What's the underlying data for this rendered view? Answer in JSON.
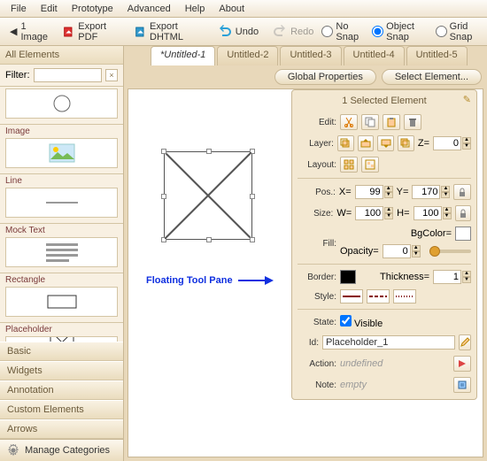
{
  "menu": {
    "file": "File",
    "edit": "Edit",
    "prototype": "Prototype",
    "advanced": "Advanced",
    "help": "Help",
    "about": "About"
  },
  "toolbar": {
    "image": "1 Image",
    "exportPdf": "Export PDF",
    "exportDhtml": "Export DHTML",
    "undo": "Undo",
    "redo": "Redo"
  },
  "snap": {
    "noSnap": "No Snap",
    "objectSnap": "Object Snap",
    "gridSnap": "Grid Snap",
    "selected": "objectSnap"
  },
  "sidebar": {
    "header": "All Elements",
    "filterLabel": "Filter:",
    "items": [
      {
        "label": ""
      },
      {
        "label": "Image"
      },
      {
        "label": "Line"
      },
      {
        "label": "Mock Text"
      },
      {
        "label": "Rectangle"
      },
      {
        "label": "Placeholder"
      }
    ],
    "categories": [
      "Basic",
      "Widgets",
      "Annotation",
      "Custom Elements",
      "Arrows"
    ],
    "manage": "Manage Categories"
  },
  "tabs": [
    "*Untitled-1",
    "Untitled-2",
    "Untitled-3",
    "Untitled-4",
    "Untitled-5"
  ],
  "propsBar": {
    "global": "Global Properties",
    "select": "Select Element..."
  },
  "annotation": "Floating Tool Pane",
  "tp": {
    "title": "1 Selected Element",
    "labels": {
      "edit": "Edit:",
      "layer": "Layer:",
      "layout": "Layout:",
      "pos": "Pos.:",
      "size": "Size:",
      "fill": "Fill:",
      "border": "Border:",
      "style": "Style:",
      "state": "State:",
      "id": "Id:",
      "action": "Action:",
      "note": "Note:"
    },
    "pos": {
      "xLbl": "X=",
      "x": "99",
      "yLbl": "Y=",
      "y": "170"
    },
    "size": {
      "wLbl": "W=",
      "w": "100",
      "hLbl": "H=",
      "h": "100"
    },
    "layer": {
      "zLbl": "Z=",
      "z": "0"
    },
    "fill": {
      "bgLbl": "BgColor=",
      "opLbl": "Opacity=",
      "opacity": "0"
    },
    "border": {
      "thickLbl": "Thickness=",
      "thick": "1",
      "color": "#000000"
    },
    "state": {
      "visible": "Visible"
    },
    "id": "Placeholder_1",
    "action": "undefined",
    "note": "empty"
  }
}
